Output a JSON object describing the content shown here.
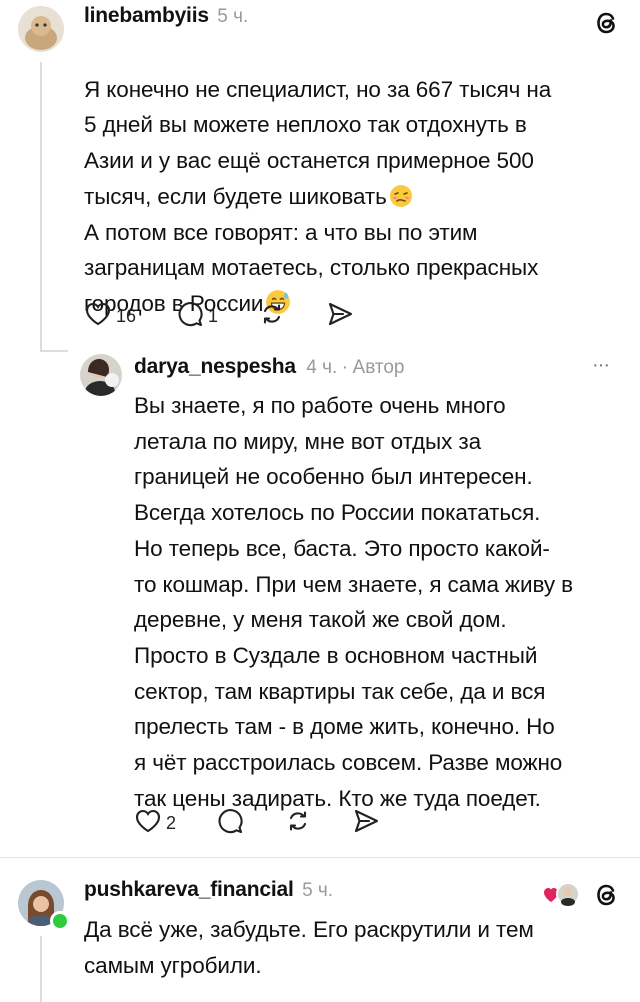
{
  "comments": [
    {
      "username": "linebambyiis",
      "time": "5 ч.",
      "text": "Я конечно не специалист, но за 667 тысяч на\n5 дней вы можете неплохо так отдохнуть в\nАзии и у вас ещё останется примерное 500\nтысяч, если будете шиковать",
      "text2": "А потом все говорят: а что вы по этим\nзаграницам мотаетесь, столько прекрасных\nгородов в России",
      "likes": "16",
      "replies": "1",
      "emoji1": "woozy-face",
      "emoji2": "grinning-sweat-face"
    },
    {
      "username": "darya_nespesha",
      "time": "4 ч.",
      "separator": "·",
      "author_label": "Автор",
      "more": "···",
      "text": "Вы знаете, я по работе очень много\nлетала по миру, мне вот отдых за\nграницей не особенно был интересен.\nВсегда хотелось по России покататься.\nНо теперь все, баста. Это просто какой-\nто кошмар. При чем знаете, я сама живу в\nдеревне, у меня такой же свой дом.\nПросто в Суздале в основном частный\nсектор, там квартиры так себе, да и вся\nпрелесть там - в доме жить, конечно. Но\nя чёт расстроилась совсем. Разве можно\nтак цены задирать. Кто же туда поедет.",
      "likes": "2"
    },
    {
      "username": "pushkareva_financial",
      "time": "5 ч.",
      "text": "Да всё уже, забудьте. Его раскрутили и тем\nсамым угробили."
    }
  ],
  "colors": {
    "online": "#2ecc40",
    "heart": "#e0245e",
    "muted": "#9a9a9a"
  }
}
